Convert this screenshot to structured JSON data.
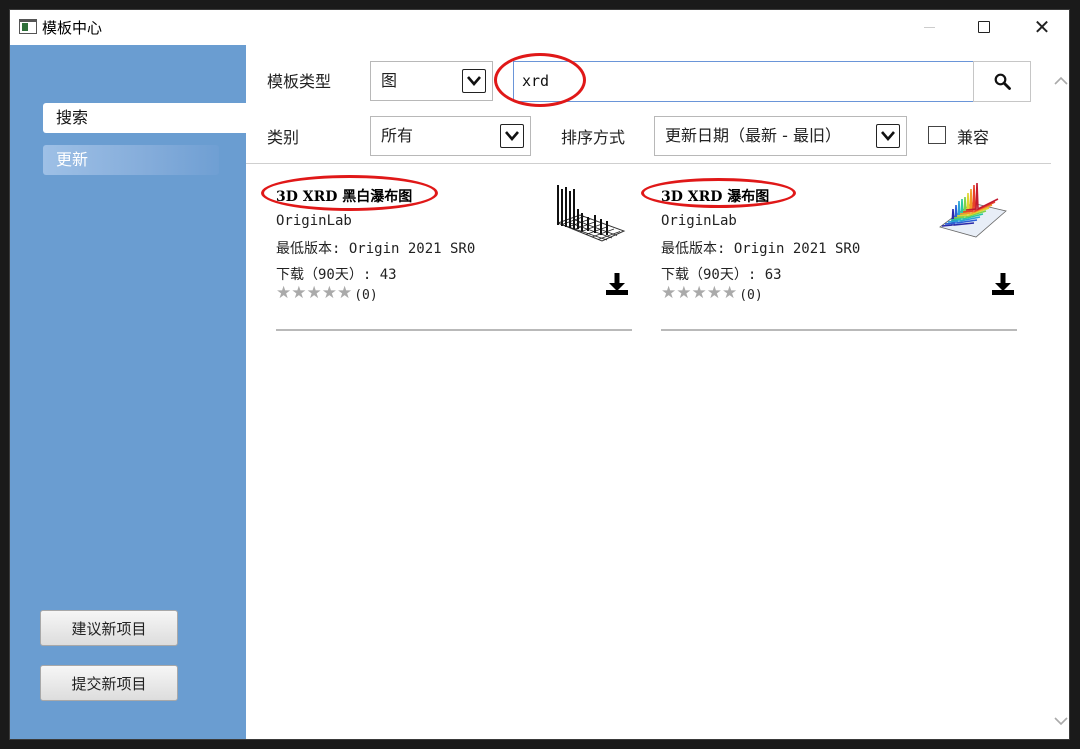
{
  "window": {
    "title": "模板中心",
    "controls": {
      "minimize_icon": "minimize-icon",
      "maximize_icon": "maximize-icon",
      "close_icon": "close-icon",
      "close_glyph": "✕"
    }
  },
  "sidebar": {
    "items": [
      {
        "label": "搜索",
        "selected": true
      },
      {
        "label": "更新",
        "selected": false
      }
    ],
    "buttons": {
      "suggest": "建议新项目",
      "submit": "提交新项目"
    }
  },
  "filters": {
    "template_type_label": "模板类型",
    "template_type_value": "图",
    "search_value": "xrd",
    "category_label": "类别",
    "category_value": "所有",
    "sort_label": "排序方式",
    "sort_value": "更新日期（最新 - 最旧）",
    "compatible_label": "兼容",
    "compatible_checked": false
  },
  "results": [
    {
      "title": "3D XRD 黑白瀑布图",
      "author": "OriginLab",
      "min_version": "最低版本: Origin 2021 SR0",
      "downloads": "下载（90天）: 43",
      "stars": "★★★★★",
      "rating_count": "(0)",
      "thumbnail": "bw-waterfall-thumbnail"
    },
    {
      "title": "3D XRD 瀑布图",
      "author": "OriginLab",
      "min_version": "最低版本: Origin 2021 SR0",
      "downloads": "下载（90天）: 63",
      "stars": "★★★★★",
      "rating_count": "(0)",
      "thumbnail": "color-waterfall-thumbnail"
    }
  ],
  "colors": {
    "sidebar_bg": "#6a9dd1",
    "highlight_ellipse": "#e01818",
    "search_border": "#6a95d8",
    "star_empty": "#aaaaaa"
  }
}
